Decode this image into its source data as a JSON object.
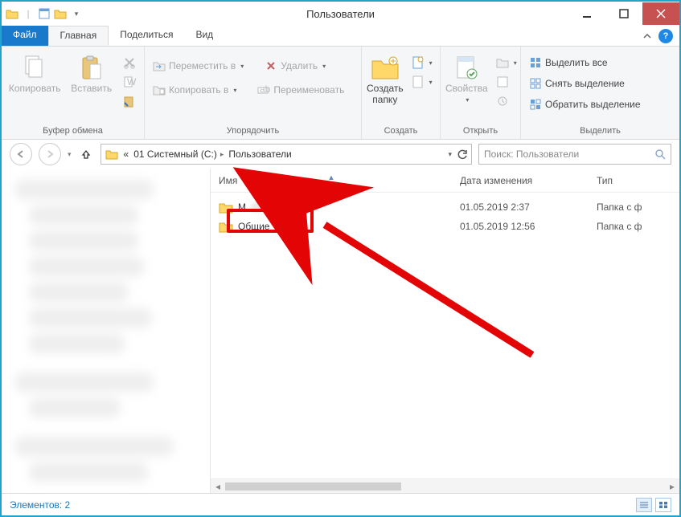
{
  "window": {
    "title": "Пользователи"
  },
  "tabs": {
    "file": "Файл",
    "home": "Главная",
    "share": "Поделиться",
    "view": "Вид"
  },
  "ribbon": {
    "clipboard": {
      "label": "Буфер обмена",
      "copy": "Копировать",
      "paste": "Вставить"
    },
    "organize": {
      "label": "Упорядочить",
      "move_to": "Переместить в",
      "copy_to": "Копировать в",
      "delete": "Удалить",
      "rename": "Переименовать"
    },
    "new": {
      "label": "Создать",
      "new_folder": "Создать\nпапку"
    },
    "open": {
      "label": "Открыть",
      "properties": "Свойства"
    },
    "select": {
      "label": "Выделить",
      "select_all": "Выделить все",
      "select_none": "Снять выделение",
      "invert": "Обратить выделение"
    }
  },
  "breadcrumb": {
    "truncate": "«",
    "drive": "01 Системный (C:)",
    "folder": "Пользователи"
  },
  "search": {
    "placeholder": "Поиск: Пользователи"
  },
  "columns": {
    "name": "Имя",
    "date": "Дата изменения",
    "type": "Тип"
  },
  "items": [
    {
      "name": "M",
      "date": "01.05.2019 2:37",
      "type": "Папка с ф"
    },
    {
      "name": "Общие",
      "date": "01.05.2019 12:56",
      "type": "Папка с ф"
    }
  ],
  "status": {
    "text": "Элементов: 2"
  }
}
